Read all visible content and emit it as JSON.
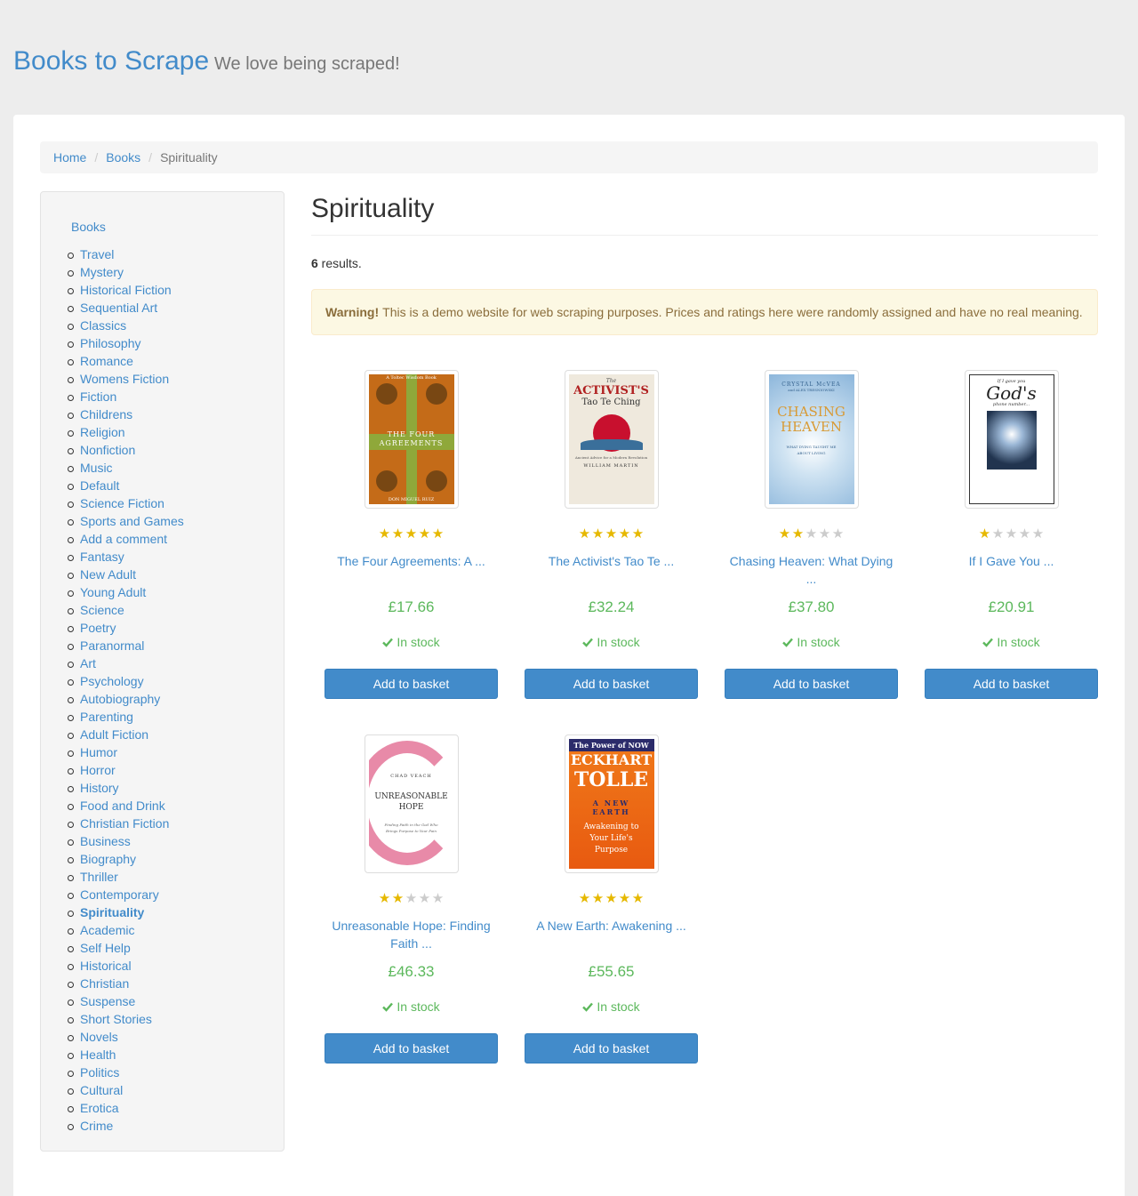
{
  "header": {
    "brand": "Books to Scrape",
    "tagline": "We love being scraped!"
  },
  "breadcrumb": [
    "Home",
    "Books",
    "Spirituality"
  ],
  "sidebar": {
    "root": "Books",
    "active": "Spirituality",
    "categories": [
      "Travel",
      "Mystery",
      "Historical Fiction",
      "Sequential Art",
      "Classics",
      "Philosophy",
      "Romance",
      "Womens Fiction",
      "Fiction",
      "Childrens",
      "Religion",
      "Nonfiction",
      "Music",
      "Default",
      "Science Fiction",
      "Sports and Games",
      "Add a comment",
      "Fantasy",
      "New Adult",
      "Young Adult",
      "Science",
      "Poetry",
      "Paranormal",
      "Art",
      "Psychology",
      "Autobiography",
      "Parenting",
      "Adult Fiction",
      "Humor",
      "Horror",
      "History",
      "Food and Drink",
      "Christian Fiction",
      "Business",
      "Biography",
      "Thriller",
      "Contemporary",
      "Spirituality",
      "Academic",
      "Self Help",
      "Historical",
      "Christian",
      "Suspense",
      "Short Stories",
      "Novels",
      "Health",
      "Politics",
      "Cultural",
      "Erotica",
      "Crime"
    ]
  },
  "main": {
    "heading": "Spirituality",
    "results_count": "6",
    "results_suffix": " results.",
    "alert_strong": "Warning!",
    "alert_text": "This is a demo website for web scraping purposes. Prices and ratings here were randomly assigned and have no real meaning."
  },
  "products": [
    {
      "title": "The Four Agreements: A ...",
      "price": "£17.66",
      "rating": 5,
      "stock": "In stock",
      "button": "Add to basket",
      "cover": "four-agreements"
    },
    {
      "title": "The Activist's Tao Te ...",
      "price": "£32.24",
      "rating": 5,
      "stock": "In stock",
      "button": "Add to basket",
      "cover": "activists-tao"
    },
    {
      "title": "Chasing Heaven: What Dying ...",
      "price": "£37.80",
      "rating": 2,
      "stock": "In stock",
      "button": "Add to basket",
      "cover": "chasing-heaven"
    },
    {
      "title": "If I Gave You ...",
      "price": "£20.91",
      "rating": 1,
      "stock": "In stock",
      "button": "Add to basket",
      "cover": "if-i-gave-you"
    },
    {
      "title": "Unreasonable Hope: Finding Faith ...",
      "price": "£46.33",
      "rating": 2,
      "stock": "In stock",
      "button": "Add to basket",
      "cover": "unreasonable-hope"
    },
    {
      "title": "A New Earth: Awakening ...",
      "price": "£55.65",
      "rating": 5,
      "stock": "In stock",
      "button": "Add to basket",
      "cover": "new-earth"
    }
  ],
  "covers": {
    "four-agreements": {
      "top": "A Toltec Wisdom Book",
      "title": "THE FOUR AGREEMENTS",
      "author": "DON MIGUEL RUIZ"
    },
    "activists-tao": {
      "pre": "The",
      "title": "ACTIVIST'S",
      "sub": "Tao Te Ching",
      "tag": "Ancient Advice for a Modern Revolution",
      "author": "WILLIAM MARTIN"
    },
    "chasing-heaven": {
      "author": "CRYSTAL McVEA",
      "co": "and ALEX TRESNIOWSKI",
      "title": "CHASING HEAVEN",
      "sub": "WHAT DYING TAUGHT ME ABOUT LIVING"
    },
    "if-i-gave-you": {
      "pre": "If I gave you",
      "title": "God's",
      "sub": "phone number..."
    },
    "unreasonable-hope": {
      "author": "CHAD VEACH",
      "title": "UNREASONABLE HOPE",
      "sub": "Finding Faith in the God Who Brings Purpose to Your Pain"
    },
    "new-earth": {
      "top": "The Power of NOW",
      "author1": "ECKHART",
      "author2": "TOLLE",
      "title": "A NEW EARTH",
      "sub": "Awakening to Your Life's Purpose"
    }
  },
  "colors": {
    "link": "#428bca",
    "price": "#5cb85c",
    "star": "#e6b800",
    "alert_bg": "#fcf8e3"
  }
}
